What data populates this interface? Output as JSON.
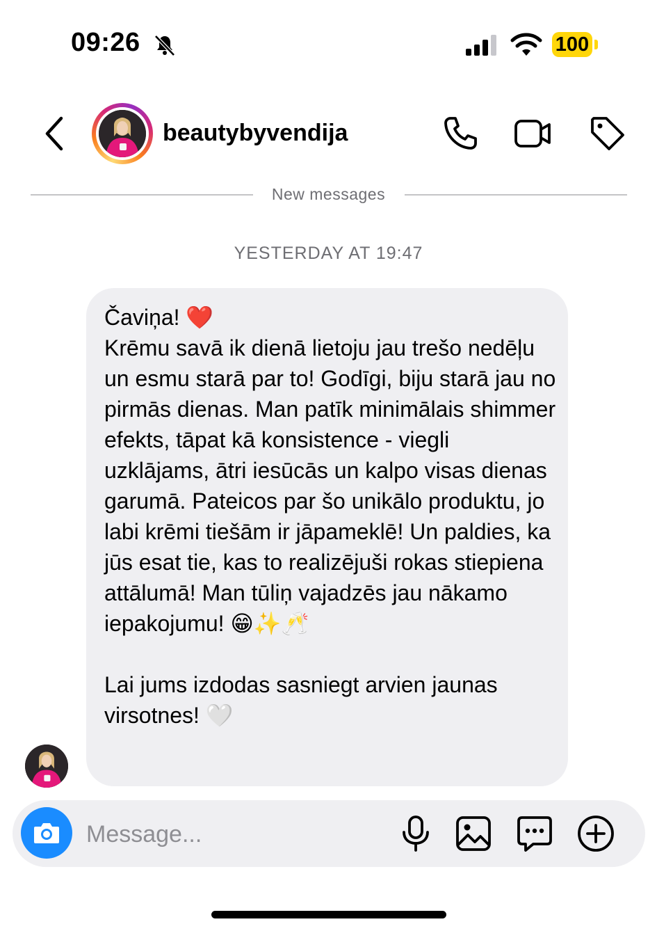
{
  "status_bar": {
    "time": "09:26",
    "battery": "100",
    "icons": [
      "bell-slash-icon",
      "signal-icon",
      "wifi-icon",
      "battery-icon"
    ]
  },
  "header": {
    "username": "beautybyvendija",
    "icons": [
      "back-chevron-icon",
      "phone-icon",
      "video-icon",
      "tag-icon"
    ]
  },
  "divider": {
    "label": "New messages"
  },
  "thread": {
    "date_label": "YESTERDAY AT 19:47",
    "message": {
      "text": "Čaviņa! ❤️\nKrēmu savā ik dienā lietoju jau trešo nedēļu un esmu starā par to! Godīgi, biju starā jau no pirmās dienas. Man patīk minimālais shimmer efekts, tāpat kā konsistence - viegli uzklājams, ātri iesūcās un kalpo visas dienas garumā. Pateicos par šo unikālo produktu, jo labi krēmi tiešām ir jāpameklē! Un paldies, ka jūs esat tie, kas to realizējuši rokas stiepiena attālumā! Man tūliņ vajadzēs jau nākamo iepakojumu! 😁✨🥂\n\nLai jums izdodas sasniegt arvien jaunas virsotnes! 🤍"
    }
  },
  "composer": {
    "placeholder": "Message...",
    "value": "",
    "icons": [
      "camera-icon",
      "microphone-icon",
      "gallery-icon",
      "sticker-chat-icon",
      "plus-icon"
    ]
  },
  "colors": {
    "accent_blue": "#1a8cff",
    "bubble_gray": "#efeff2",
    "battery_yellow": "#ffd60a",
    "muted_text": "#6e6e73"
  }
}
